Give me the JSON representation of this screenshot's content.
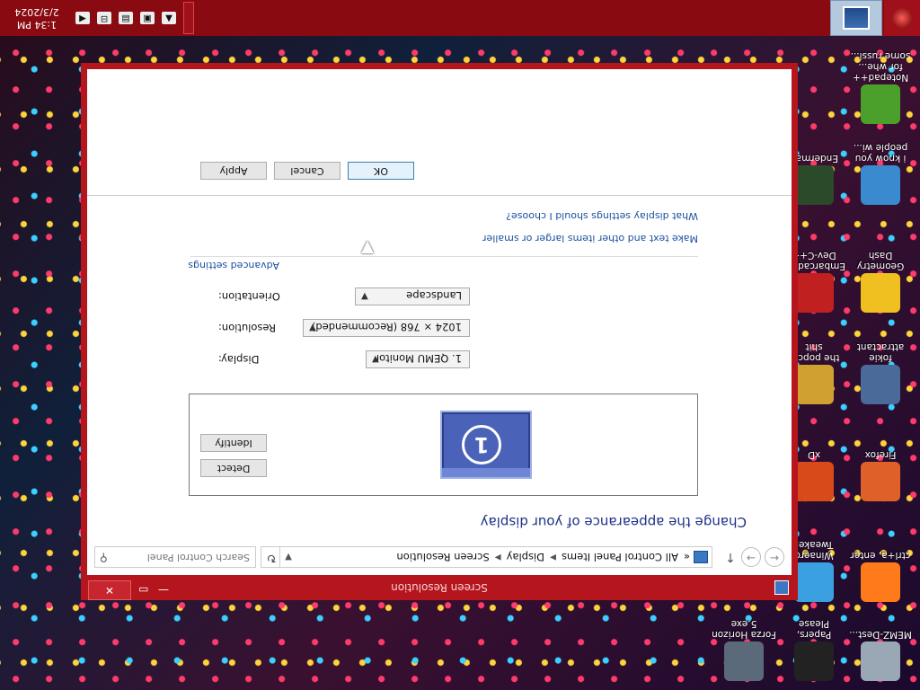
{
  "window": {
    "title": "Screen Resolution",
    "close_label": "✕",
    "minimize_label": "—",
    "maximize_label": "▭"
  },
  "address": {
    "crumbs": [
      "All Control Panel Items",
      "Display",
      "Screen Resolution"
    ],
    "prefix": "«",
    "search_placeholder": "Search Control Panel"
  },
  "main": {
    "heading": "Change the appearance of your display",
    "monitor_number": "1",
    "detect_label": "Detect",
    "identify_label": "Identify",
    "display_label": "Display:",
    "display_value": "1. QEMU Monitor",
    "resolution_label": "Resolution:",
    "resolution_value": "1024 × 768 (Recommended)",
    "orientation_label": "Orientation:",
    "orientation_value": "Landscape",
    "advanced_link": "Advanced settings",
    "text_size_link": "Make text and other items larger or smaller",
    "which_settings_link": "What display settings should I choose?",
    "ok_label": "OK",
    "cancel_label": "Cancel",
    "apply_label": "Apply"
  },
  "desktop": {
    "icons": [
      {
        "label": "MEMZ-Dest...",
        "color": "#9aa7b5"
      },
      {
        "label": "Papers, Please",
        "color": "#222222"
      },
      {
        "label": "Forza Horizon 5.exe",
        "color": "#5a6a7a"
      },
      {
        "label": "ctrl+a, enter",
        "color": "#ff7a1a"
      },
      {
        "label": "Winaero Tweaker",
        "color": "#3aa0e0"
      },
      {
        "label": "Firefox",
        "color": "#e0602a"
      },
      {
        "label": "xD",
        "color": "#d94a1a"
      },
      {
        "label": "fokie attractant",
        "color": "#4a6a9a"
      },
      {
        "label": "the popcat shit",
        "color": "#d0a030"
      },
      {
        "label": "Geometry Dash",
        "color": "#f0c020"
      },
      {
        "label": "Embarcadero Dev-C++",
        "color": "#c02020"
      },
      {
        "label": "i know you people wi...",
        "color": "#3a8ad0"
      },
      {
        "label": "Enderman",
        "color": "#2a4a2a"
      },
      {
        "label": "Notepad++ for whe... some russi...",
        "color": "#4aa02a"
      }
    ]
  },
  "taskbar": {
    "time": "1:34 PM",
    "date": "2/3/2024"
  }
}
